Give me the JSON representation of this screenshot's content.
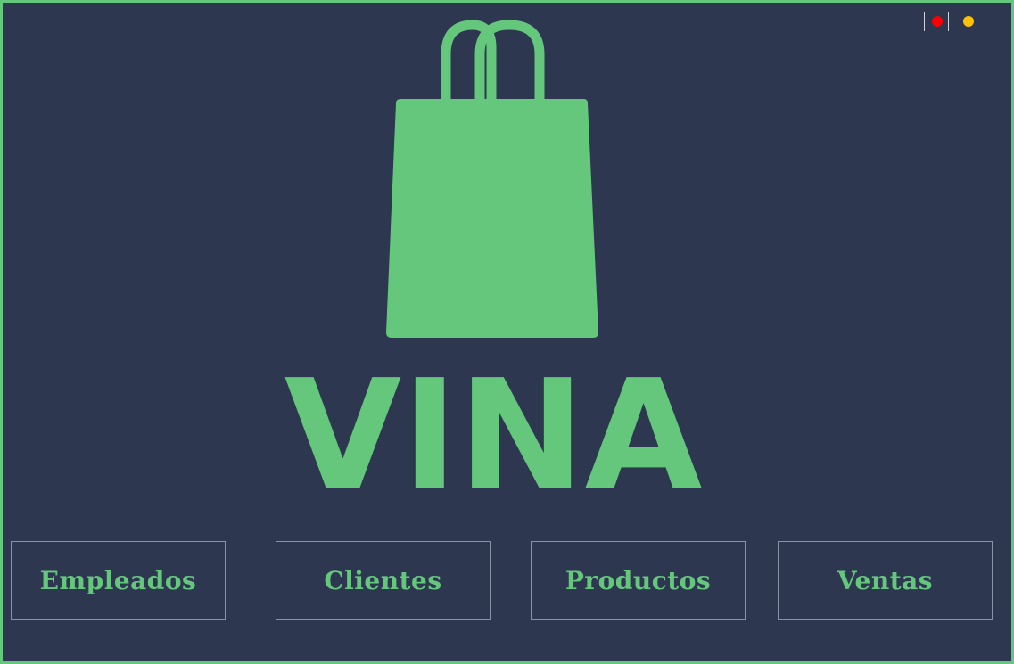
{
  "app": {
    "brand_name": "VINA"
  },
  "window_controls": {
    "close_color": "#ff0000",
    "minimize_color": "#ffc107"
  },
  "logo": {
    "icon": "shopping-bag-icon",
    "color": "#64c77c"
  },
  "colors": {
    "background": "#2d3750",
    "accent": "#64c77c",
    "button_border": "#8a92a6"
  },
  "nav": {
    "buttons": [
      {
        "label": "Empleados"
      },
      {
        "label": "Clientes"
      },
      {
        "label": "Productos"
      },
      {
        "label": "Ventas"
      }
    ]
  }
}
